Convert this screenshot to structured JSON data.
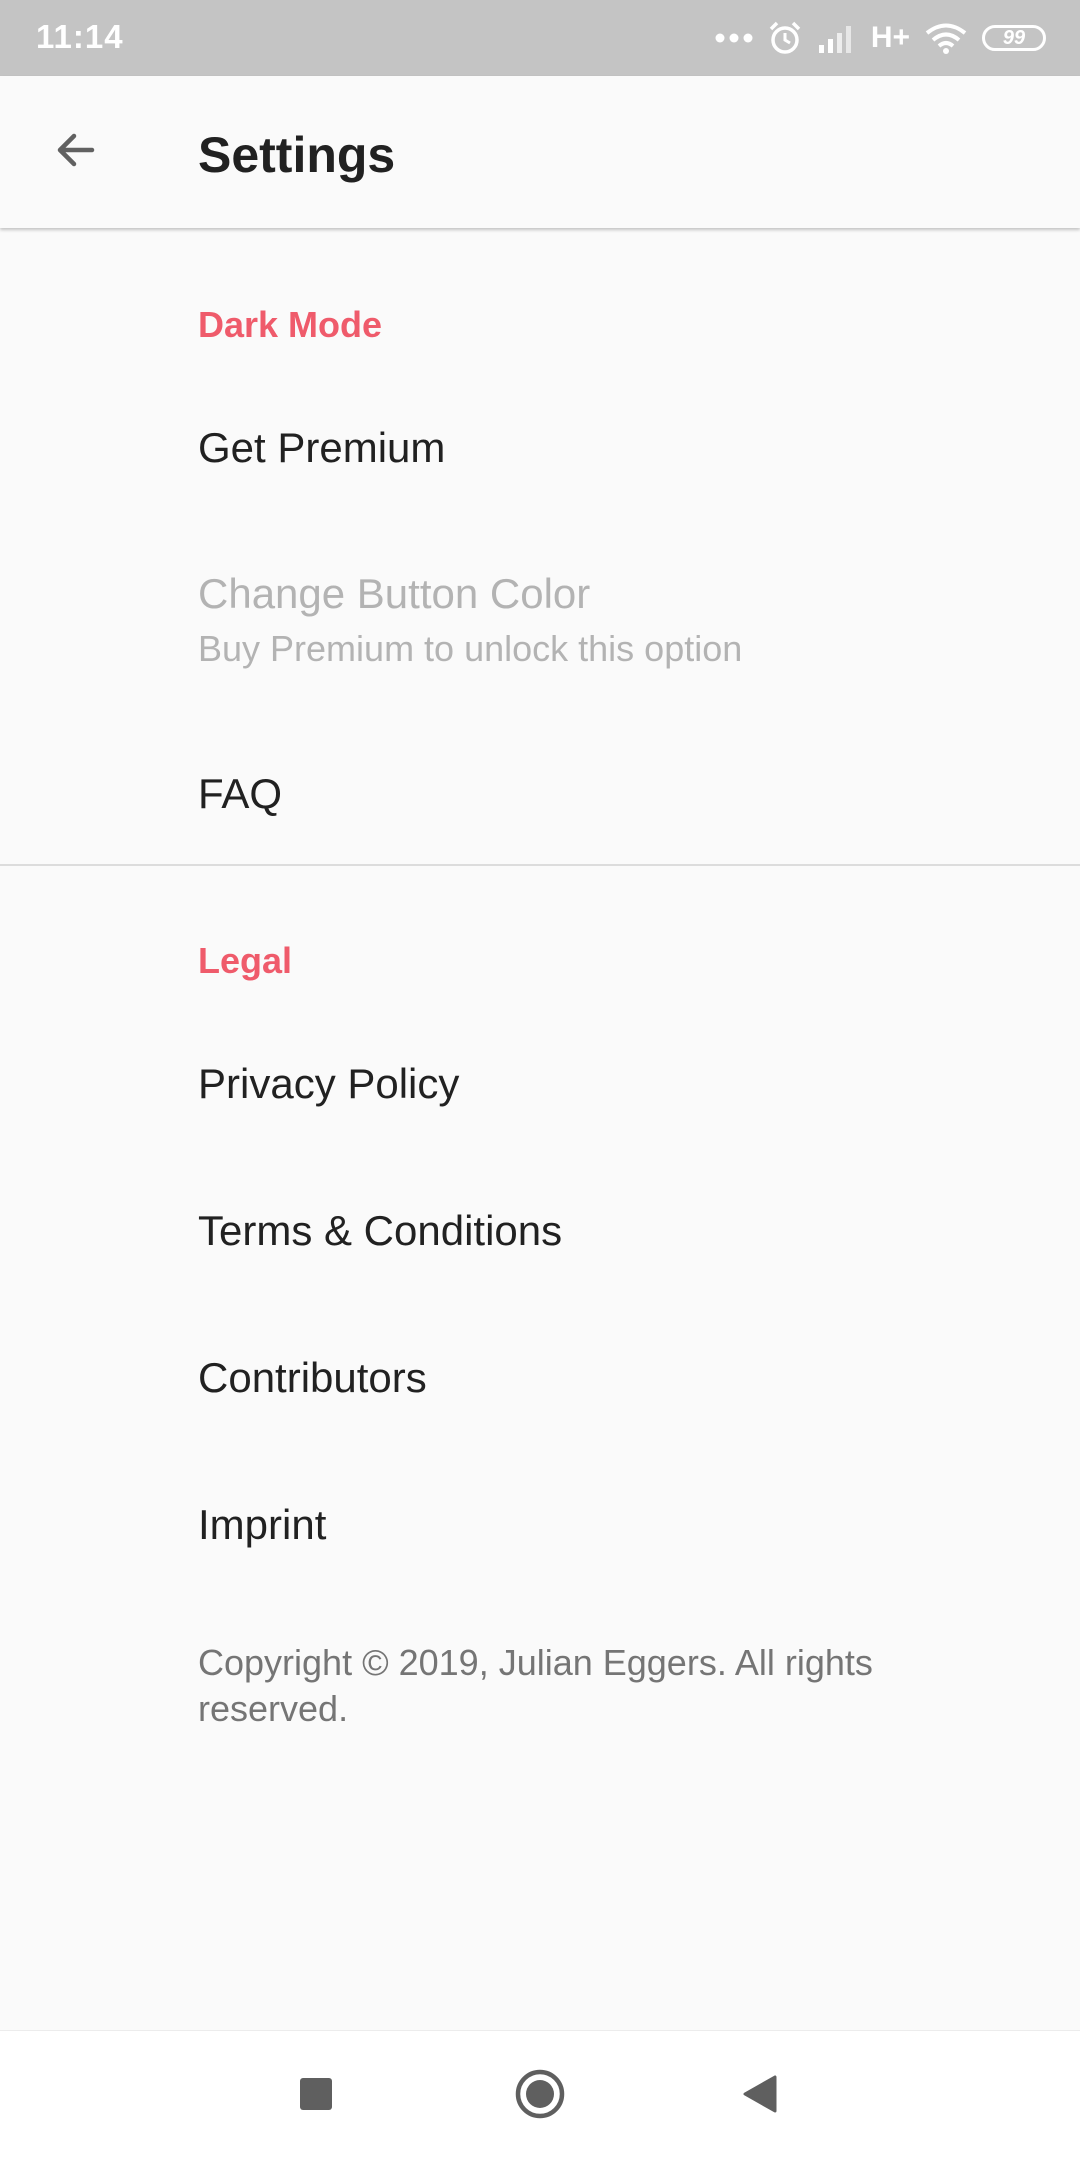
{
  "status_bar": {
    "time": "11:14",
    "network": "H+",
    "battery": "99",
    "icons": [
      "more-dots-icon",
      "alarm-icon",
      "signal-icon",
      "wifi-icon",
      "battery-icon"
    ]
  },
  "app_bar": {
    "title": "Settings",
    "back_icon": "arrow-back-icon"
  },
  "sections": {
    "dark_mode": {
      "header": "Dark Mode",
      "items": {
        "get_premium": {
          "title": "Get Premium"
        },
        "change_button_color": {
          "title": "Change Button Color",
          "summary": "Buy Premium to unlock this option",
          "enabled": false
        },
        "faq": {
          "title": "FAQ"
        }
      }
    },
    "legal": {
      "header": "Legal",
      "items": {
        "privacy_policy": {
          "title": "Privacy Policy"
        },
        "terms": {
          "title": "Terms & Conditions"
        },
        "contributors": {
          "title": "Contributors"
        },
        "imprint": {
          "title": "Imprint"
        }
      }
    }
  },
  "footer": {
    "copyright": "Copyright © 2019, Julian Eggers. All rights reserved."
  },
  "nav_bar": {
    "icons": [
      "recents-square-icon",
      "home-circle-icon",
      "back-triangle-icon"
    ]
  },
  "colors": {
    "accent": "#ef5b6b",
    "status_bar": "#c4c4c4",
    "background": "#fafafa",
    "disabled_text": "#b3b3b3"
  }
}
